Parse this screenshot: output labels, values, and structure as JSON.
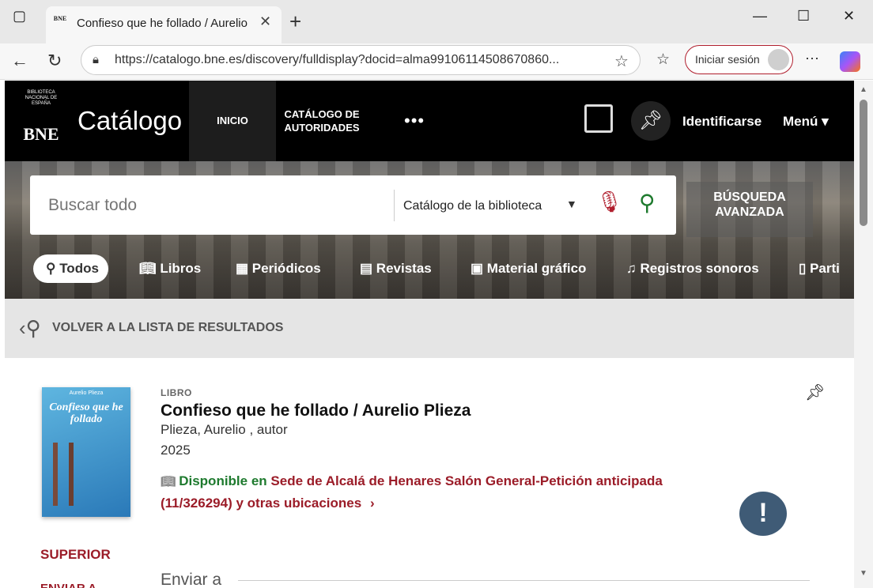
{
  "browser": {
    "tab_title": "Confieso que he follado / Aurelio",
    "favicon_text": "BNE",
    "url": "https://catalogo.bne.es/discovery/fulldisplay?docid=alma99106114508670860...",
    "login_label": "Iniciar sesión"
  },
  "header": {
    "logo_small": "BIBLIOTECA NACIONAL DE ESPAÑA",
    "logo_big": "BNE",
    "title": "Catálogo",
    "nav": [
      {
        "label": "INICIO"
      },
      {
        "label": "CATÁLOGO DE AUTORIDADES"
      },
      {
        "label": "•••"
      }
    ],
    "identify_label": "Identificarse",
    "menu_label": "Menú"
  },
  "search": {
    "placeholder": "Buscar todo",
    "scope": "Catálogo de la biblioteca",
    "advanced_label": "BÚSQUEDA AVANZADA"
  },
  "facets": [
    {
      "label": "Todos",
      "icon": "search-icon"
    },
    {
      "label": "Libros",
      "icon": "book-icon"
    },
    {
      "label": "Periódicos",
      "icon": "newspaper-icon"
    },
    {
      "label": "Revistas",
      "icon": "magazine-icon"
    },
    {
      "label": "Material gráfico",
      "icon": "image-icon"
    },
    {
      "label": "Registros sonoros",
      "icon": "music-icon"
    },
    {
      "label": "Parti",
      "icon": "document-icon"
    }
  ],
  "back": {
    "label": "VOLVER A LA LISTA DE RESULTADOS"
  },
  "record": {
    "type": "LIBRO",
    "title": "Confieso que he follado / Aurelio Plieza",
    "author": "Plieza, Aurelio , autor",
    "year": "2025",
    "cover_author": "Aurelio Plieza",
    "cover_title": "Confieso que he follado",
    "availability_status": "Disponible en",
    "availability_location": "Sede de Alcalá de Henares  Salón General-Petición anticipada (11/326294) y otras ubicaciones",
    "availability_chevron": "›"
  },
  "sidebar": {
    "superior": "SUPERIOR",
    "enviar": "ENVIAR A"
  },
  "section": {
    "enviar_title": "Enviar a"
  },
  "colors": {
    "brand_red": "#b01e2d",
    "available_green": "#1e7a2e",
    "header_black": "#000000"
  }
}
